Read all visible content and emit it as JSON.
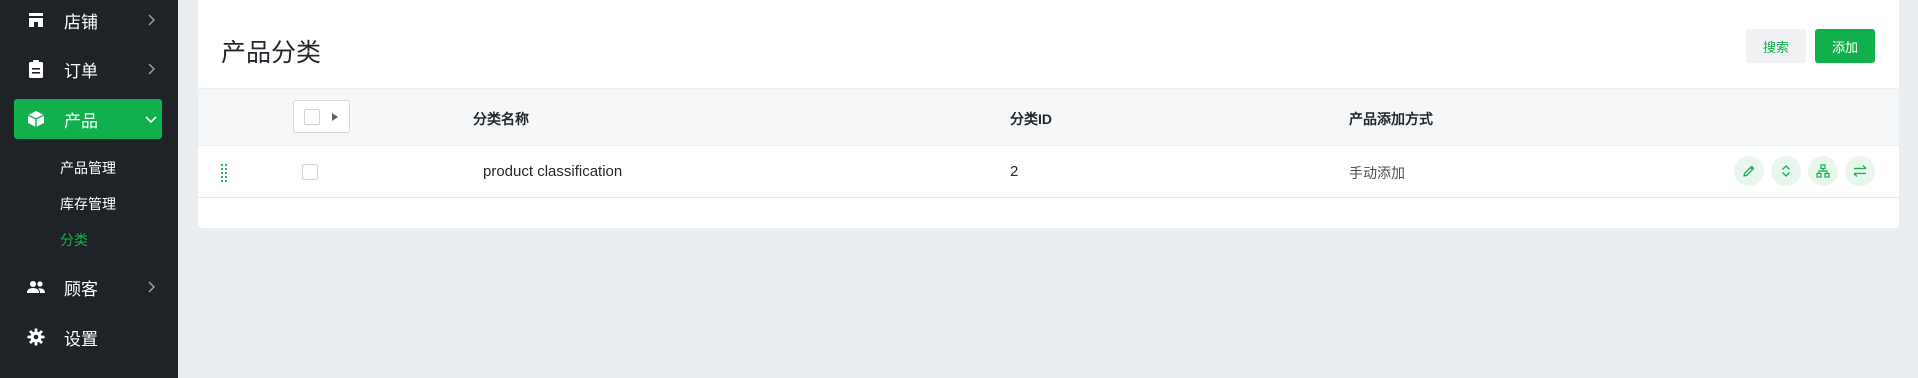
{
  "sidebar": {
    "items": [
      {
        "label": "店铺",
        "icon": "store-icon"
      },
      {
        "label": "订单",
        "icon": "clipboard-icon"
      },
      {
        "label": "产品",
        "icon": "box-icon"
      },
      {
        "label": "顾客",
        "icon": "users-icon"
      },
      {
        "label": "设置",
        "icon": "gear-icon"
      }
    ],
    "product_submenu": [
      {
        "label": "产品管理"
      },
      {
        "label": "库存管理"
      },
      {
        "label": "分类"
      }
    ]
  },
  "page": {
    "title": "产品分类",
    "search_label": "搜索",
    "add_label": "添加"
  },
  "table": {
    "columns": [
      "分类名称",
      "分类ID",
      "产品添加方式"
    ],
    "rows": [
      {
        "name": "product classification",
        "id": "2",
        "method": "手动添加"
      }
    ],
    "row_actions": [
      "edit-icon",
      "sort-icon",
      "hierarchy-icon",
      "transfer-icon"
    ]
  },
  "colors": {
    "sidebar_bg": "#1f2327",
    "accent": "#11b04d",
    "page_bg": "#ebeef1"
  }
}
